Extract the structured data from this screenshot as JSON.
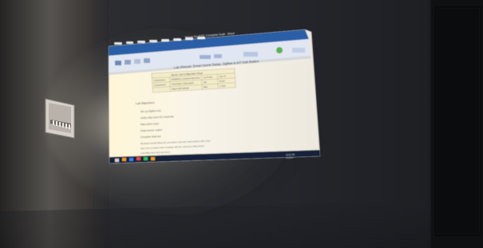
{
  "scene": {
    "description_free": true,
    "colors": {
      "room_dark": "#17191d",
      "left_wall": "#3a3736",
      "back_wall": "#25272c",
      "floor_shadow": "#111216",
      "door_frame": "#0f0f10",
      "door_inner": "#070808",
      "projection_bg": "#f6f3e6",
      "word_ribbon": "#2b5ea8",
      "word_ribbon_light": "#5f7fb8",
      "taskbar": "#13203a",
      "table_fill": "#f0e8c2",
      "plate": "#d8d2c9",
      "plate_shadow": "#8e8881"
    },
    "projected_window": {
      "title": "Figure for IOTC Complete Draft - Word",
      "document_heading": "Lab Manual: Smart Home Setup, ZigBee & IoT Hub Basics",
      "table": {
        "title": "Sensor Lab Configuration Sheet",
        "rows": [
          [
            "Component A",
            "Port",
            "ESP8266 & 2-channel relay driver",
            "Low Power",
            "3.3V 1A"
          ],
          [
            "Component B",
            "Port",
            "Push-button / Reed switch",
            "Mid",
            "5V DC"
          ],
          [
            "",
            "",
            "Status LED indicator",
            "Blue",
            "2\" pins"
          ]
        ]
      },
      "section_title": "Lab Objectives:",
      "bullets": [
        "Set up ZigBee hub",
        "Verify relay and LED response",
        "Map button input",
        "Read sensor output",
        "Complete final test"
      ],
      "paragraph_lines": [
        "Students should follow the procedure and note observations after each",
        "step, then compare their readings with the reference table before",
        "submitting their final lab sheet."
      ],
      "taskbar_time": "12:41 PM",
      "taskbar_date": "1/1/2023"
    }
  }
}
